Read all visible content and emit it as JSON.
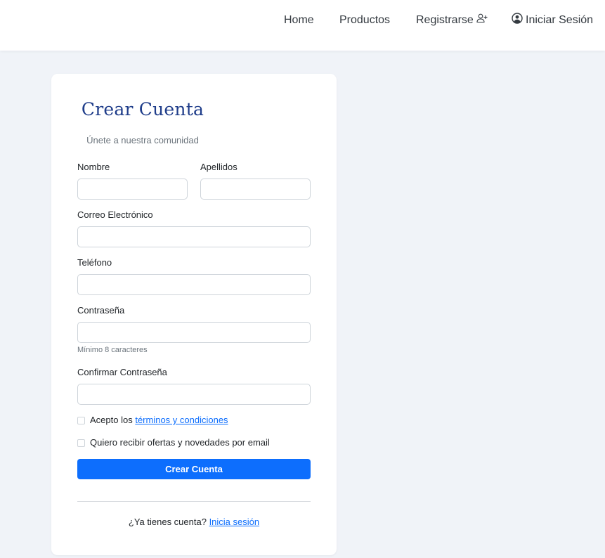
{
  "nav": {
    "home": "Home",
    "products": "Productos",
    "register": "Registrarse",
    "login": "Iniciar Sesión"
  },
  "form": {
    "title": "Crear Cuenta",
    "subtitle": "Únete a nuestra comunidad",
    "fields": {
      "first_name": {
        "label": "Nombre",
        "value": ""
      },
      "last_name": {
        "label": "Apellidos",
        "value": ""
      },
      "email": {
        "label": "Correo Electrónico",
        "value": ""
      },
      "phone": {
        "label": "Teléfono",
        "value": ""
      },
      "password": {
        "label": "Contraseña",
        "value": "",
        "hint": "Mínimo 8 caracteres"
      },
      "confirm_password": {
        "label": "Confirmar Contraseña",
        "value": ""
      }
    },
    "terms": {
      "prefix": "Acepto los ",
      "link": "términos y condiciones",
      "checked": false
    },
    "newsletter": {
      "label": "Quiero recibir ofertas y novedades por email",
      "checked": false
    },
    "submit_label": "Crear Cuenta",
    "footer": {
      "prefix": "¿Ya tienes cuenta? ",
      "link": "Inicia sesión"
    }
  },
  "colors": {
    "accent": "#0d6efd",
    "title": "#1f3d8a",
    "background": "#f0f3f8"
  },
  "icons": {
    "register": "user-plus-icon",
    "login": "user-circle-icon"
  }
}
